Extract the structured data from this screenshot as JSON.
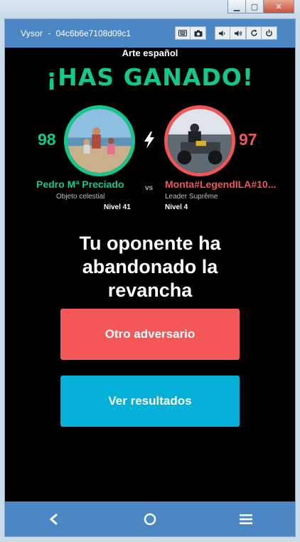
{
  "window": {
    "minimize_glyph": "▁",
    "maximize_glyph": "▢",
    "close_glyph": "✕"
  },
  "vysor": {
    "app_name": "Vysor",
    "separator": "-",
    "device_id": "04c6b6e7108d09c1",
    "tools": [
      "keyboard-icon",
      "camera-icon",
      "volume-down-icon",
      "volume-up-icon",
      "rotate-icon",
      "power-icon"
    ]
  },
  "game": {
    "category": "Arte español",
    "headline": "¡HAS GANADO!",
    "vs_label": "vs",
    "player": {
      "score": "98",
      "name": "Pedro Mª Preciado",
      "title": "Objeto celestial",
      "level": "Nivel 41"
    },
    "opponent": {
      "score": "97",
      "name": "Monta#LegendILA#10...",
      "title": "Leader Suprême",
      "level": "Nivel 4"
    },
    "message_lines": [
      "Tu oponente ha",
      "abandonado la",
      "revancha"
    ],
    "buttons": {
      "other_opponent": "Otro adversario",
      "view_results": "Ver resultados"
    }
  },
  "colors": {
    "winner": "#11c98d",
    "loser": "#f25555",
    "primary_button": "#f45757",
    "secondary_button": "#03b1d8",
    "bar": "#4b87c4"
  }
}
